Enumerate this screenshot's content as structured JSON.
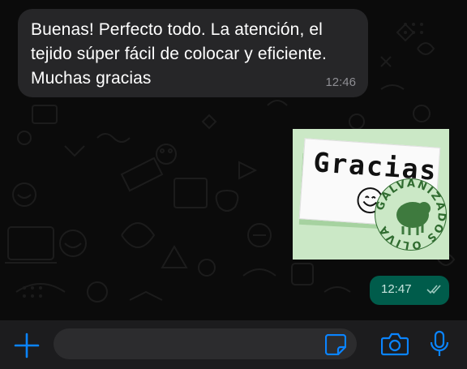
{
  "messages": {
    "incoming": {
      "text": "Buenas! Perfecto todo. La atención, el tejido súper fácil de colocar y eficiente. Muchas gracias",
      "time": "12:46"
    },
    "sticker": {
      "card_text": "Gracias",
      "logo_text": "GALVANIZADOS OLIVA"
    },
    "outgoing": {
      "time": "12:47",
      "status_icon": "double-check-icon"
    }
  },
  "composer": {
    "input_value": "",
    "icons": [
      "plus-icon",
      "sticker-icon",
      "camera-icon",
      "microphone-icon"
    ]
  },
  "colors": {
    "incoming_bubble": "#262628",
    "outgoing_bubble": "#005c4b",
    "accent": "#0a84ff",
    "background": "#0b0b0b"
  }
}
